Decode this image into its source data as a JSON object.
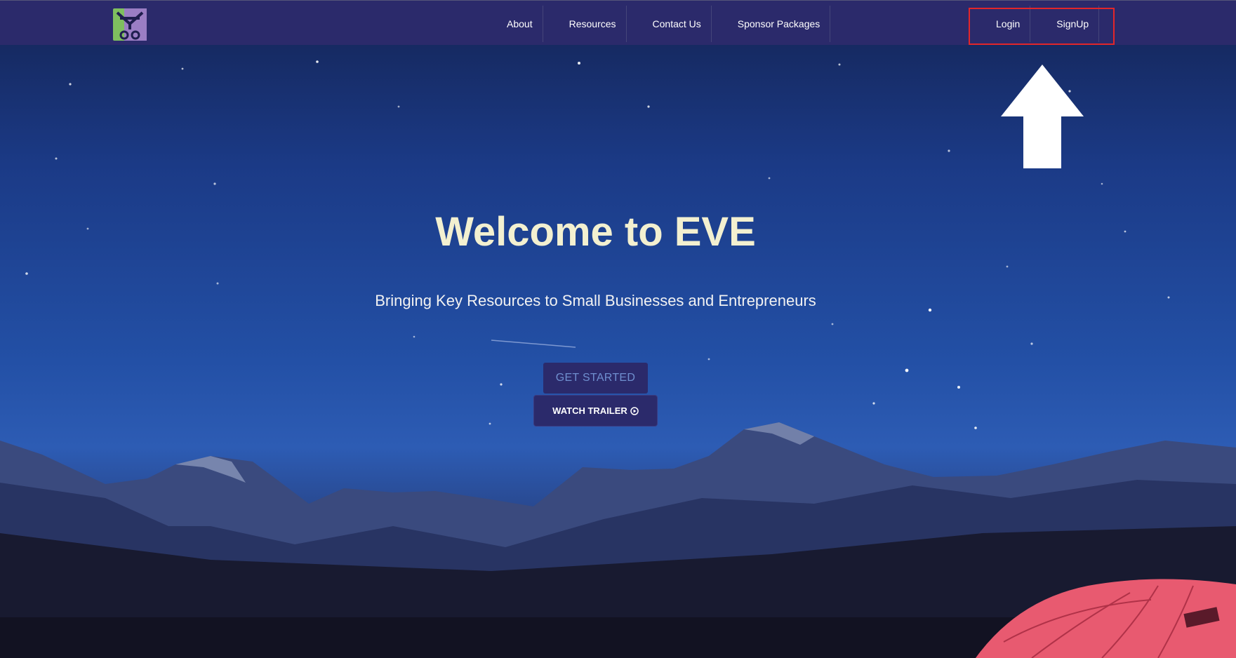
{
  "nav": {
    "logo_icon": "eve-logo-icon",
    "links": [
      {
        "label": "About"
      },
      {
        "label": "Resources"
      },
      {
        "label": "Contact Us"
      },
      {
        "label": "Sponsor Packages"
      }
    ],
    "auth": {
      "login_label": "Login",
      "signup_label": "SignUp",
      "highlight_color": "#e2262a"
    }
  },
  "hero": {
    "title": "Welcome to EVE",
    "subtitle": "Bringing Key Resources to Small Businesses and Entrepreneurs",
    "get_started_label": "GET STARTED",
    "watch_trailer_label": "WATCH TRAILER",
    "watch_trailer_icon": "play-circle-icon",
    "annotation_icon": "arrow-up-icon"
  },
  "colors": {
    "navbar": "#2b2a6b",
    "title": "#f3f0d0",
    "button": "#2b2a6b",
    "tent": "#e85a70"
  }
}
